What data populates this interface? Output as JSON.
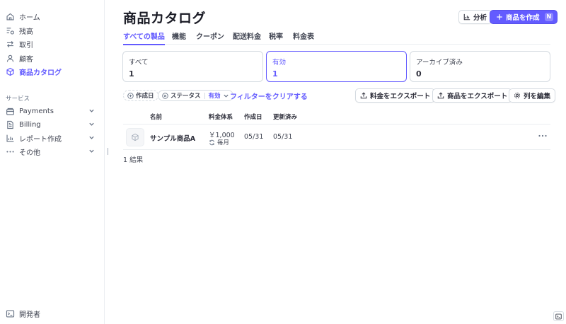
{
  "sidebar": {
    "items": [
      {
        "label": "ホーム",
        "icon": "home-icon"
      },
      {
        "label": "残高",
        "icon": "balance-icon"
      },
      {
        "label": "取引",
        "icon": "transactions-icon"
      },
      {
        "label": "顧客",
        "icon": "customer-icon"
      },
      {
        "label": "商品カタログ",
        "icon": "product-catalog-icon",
        "active": true
      }
    ],
    "section_label": "サービス",
    "services": [
      {
        "label": "Payments",
        "icon": "payments-icon"
      },
      {
        "label": "Billing",
        "icon": "billing-icon"
      },
      {
        "label": "レポート作成",
        "icon": "report-icon"
      },
      {
        "label": "その他",
        "icon": "more-icon"
      }
    ],
    "developer": {
      "label": "開発者",
      "icon": "terminal-icon"
    }
  },
  "header": {
    "title": "商品カタログ",
    "analytics_label": "分析",
    "create_label": "商品を作成",
    "create_shortcut": "N"
  },
  "tabs": [
    "すべての製品",
    "機能",
    "クーポン",
    "配送料金",
    "税率",
    "料金表"
  ],
  "filter_cards": [
    {
      "label": "すべて",
      "count": "1"
    },
    {
      "label": "有効",
      "count": "1",
      "active": true
    },
    {
      "label": "アーカイブ済み",
      "count": "0"
    }
  ],
  "filters": {
    "created_label": "作成日",
    "status_label": "ステータス",
    "status_value": "有効",
    "clear_label": "フィルターをクリアする"
  },
  "actions": {
    "export_prices": "料金をエクスポート",
    "export_products": "商品をエクスポート",
    "edit_columns": "列を編集"
  },
  "table": {
    "headers": {
      "name": "名前",
      "pricing": "料金体系",
      "created": "作成日",
      "updated": "更新済み"
    },
    "rows": [
      {
        "name": "サンプル商品A",
        "price": "￥1,000",
        "interval": "毎月",
        "created": "05/31",
        "updated": "05/31"
      }
    ],
    "results": "1 結果"
  },
  "colors": {
    "accent": "#635bff",
    "text": "#30313d",
    "muted": "#687385",
    "border": "#d5dbe1"
  }
}
